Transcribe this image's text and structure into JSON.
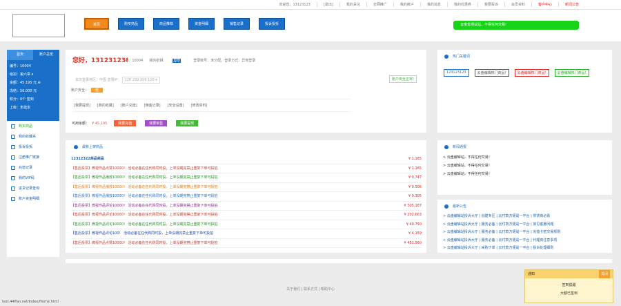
{
  "topbar": {
    "links": [
      "欢迎您，13123123",
      "[退出]",
      "我的关注",
      "全网推广",
      "我的账户",
      "我的消息",
      "我的优惠券",
      "我要投诉",
      "会员资料",
      "客户中心",
      "新闻公告"
    ]
  },
  "nav": [
    "首页",
    "购买商品",
    "商品推荐",
    "资金明细",
    "销售记录",
    "投诉投拆"
  ],
  "notice_pill": "云南省测试站，不得任何交易!",
  "sidebar": {
    "tabs": [
      "首页",
      "账户总览"
    ],
    "info": [
      "编号：10004",
      "级别：第六章 ▾",
      "余额：45.195 元 ⊕",
      "冻结：56.000 元",
      "积分：0个 签到",
      "上级：未指定"
    ],
    "menu": [
      "购买商品",
      "我的收藏夹",
      "投诉投拆",
      "注册推广链接",
      "充值记录",
      "我的VIP码",
      "进货记录查询",
      "账户资金明细"
    ]
  },
  "account": {
    "hello": "您好，13123123!",
    "id": "ID：10004",
    "key_label": "我的密钥：",
    "key_btn": "显示",
    "meta_extra": "登录账号：未分配，登录方式：异地登录",
    "login": "本次登录地区：中国  登录IP：",
    "login_ip": "120.239.206.120",
    "safe_ok": "账户安全正常!",
    "safety_label": "账户安全：",
    "safety_level": "低",
    "quick_links": [
      "[我要提现]",
      "[我的收藏]",
      "[账户充值]",
      "[佣金记录]",
      "[安全设置]",
      "[修改资料]"
    ],
    "balance_label": "可用余额：",
    "balance_amount": "¥ 45.195",
    "buttons": [
      {
        "label": "我要充值",
        "color": "#f2653a"
      },
      {
        "label": "我要销售",
        "color": "#a44ec8"
      },
      {
        "label": "我要提现",
        "color": "#46b83b"
      }
    ]
  },
  "hot": {
    "title": "热门关键词",
    "tags": [
      {
        "label": "123123123",
        "color": "#1a6fc9"
      },
      {
        "label": "云盘编辑热门商品!",
        "color": "#555"
      },
      {
        "label": "云盘编辑热门商品!",
        "color": "#d22"
      },
      {
        "label": "云盘编辑热门商品!",
        "color": "#2a2"
      }
    ]
  },
  "orders": {
    "title": "最新上架商品",
    "rows": [
      {
        "text": "12312322商品商品",
        "price": "¥ 1.165",
        "color": "#1a5fa8",
        "bold": true
      },
      {
        "text": "【售后投票】微视作品点赞10000！ 活动必备在任代购同时投，上单没期完禁止重复下单可投拍",
        "price": "¥ 1.165",
        "color": "#c0392b"
      },
      {
        "text": "【售后投票】微视作品播放10000！ 活动必备在任代购同时投，上单没期完禁止重复下单可投拍",
        "price": "¥ 0.747",
        "color": "#2a8a2a"
      },
      {
        "text": "【售后投票】微视作品播放10000！ 活动必备在任代购同时投，上单没期完禁止重复下单可投拍",
        "price": "¥ 0.506",
        "color": "#d87a16"
      },
      {
        "text": "【售后投票】微视作品播放10000！ 活动必备在任代购同时投，上单没期完禁止重复下单可投拍",
        "price": "¥ 0.305",
        "color": "#1a6fc9"
      },
      {
        "text": "【售后投票】微视作品评论10000！ 活动必备在任代购同时投，上单没期完禁止重复下单可投拍",
        "price": "¥ 305.187",
        "color": "#8e2a8e"
      },
      {
        "text": "【售后投票】微视作品评论10000！ 活动必备在任代购同时投，上单没期完禁止重复下单可投拍",
        "price": "¥ 202.663",
        "color": "#c0392b"
      },
      {
        "text": "【售后投票】微视作品评论10000！ 活动必备在任代购同时投，上单没期完禁止重复下单可投拍",
        "price": "¥ 40.750",
        "color": "#2a8a2a"
      },
      {
        "text": "【售后投票】微视作品评论100！ 活动必备在任代购同时投，上单没期完禁止重复下单可投拍",
        "price": "¥ 4.159",
        "color": "#1a3fa8"
      },
      {
        "text": "【售后投票】微视作品点赞10000！ 活动必备在任代购同时投，上单没期完禁止重复下单可投拍",
        "price": "¥ 451.560",
        "color": "#c0392b"
      }
    ]
  },
  "news": {
    "title": "新闻通报",
    "items": [
      "> 云盘编辑站，不得任何交易！",
      "> 云盘编辑站，不得任何交易！",
      "> 云盘编辑站，不得任何交易！"
    ]
  },
  "notice": {
    "title": "最新公告",
    "items": [
      "> 云盘编辑站投诉大厅 | 创建专区 | 云付款方便是一平台 | 供货商必看",
      "> 云盘编辑站投诉大厅 | 服务必备 | 云付款方便是一平台 | 常见客服问题",
      "> 云盘编辑站投诉大厅 | 服务必备 | 云付款方便是一平台 | 充值卡密交易规则",
      "> 云盘编辑站投诉大厅 | 服务必备 | 云付款方便是一平台 | 代理商注意事项",
      "> 云盘编辑站投诉大厅 | 采购下单 | 云付款方便是一平台 | 投诉处理细则"
    ]
  },
  "footer": "关于我们 | 联系方式 | 帮助中心",
  "status_url": "test.44ffan.net/Index/Home.html",
  "float_box": {
    "head": "通知",
    "close": "关闭",
    "line1": "签到提醒",
    "line2": "大都已签到"
  }
}
